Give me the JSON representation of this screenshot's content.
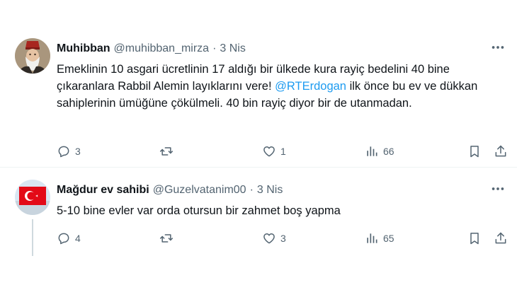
{
  "tweets": [
    {
      "display_name": "Muhibban",
      "handle": "@muhibban_mirza",
      "separator": "·",
      "time": "3 Nis",
      "text_before": "Emeklinin 10 asgari ücretlinin 17 aldığı bir ülkede kura rayiç bedelini 40 bine çıkaranlara Rabbil Alemin layıklarını vere! ",
      "mention": "@RTErdogan",
      "text_after": " ilk önce bu ev ve dükkan sahiplerinin ümüğüne çökülmeli. 40 bin rayiç diyor bir de utanmadan.",
      "replies": "3",
      "retweets": "",
      "likes": "1",
      "views": "66"
    },
    {
      "display_name": "Mağdur ev sahibi",
      "handle": "@Guzelvatanim00",
      "separator": "·",
      "time": "3 Nis",
      "text": "5-10 bine evler var orda otursun bir zahmet boş yapma",
      "replies": "4",
      "retweets": "",
      "likes": "3",
      "views": "65"
    }
  ],
  "icons": {
    "more": "more-horizontal-icon",
    "reply": "reply-icon",
    "retweet": "retweet-icon",
    "like": "heart-icon",
    "views": "views-chart-icon",
    "bookmark": "bookmark-icon",
    "share": "share-icon"
  },
  "colors": {
    "text": "#0f1419",
    "secondary": "#536471",
    "link": "#1d9bf0",
    "divider": "#eff3f4"
  }
}
